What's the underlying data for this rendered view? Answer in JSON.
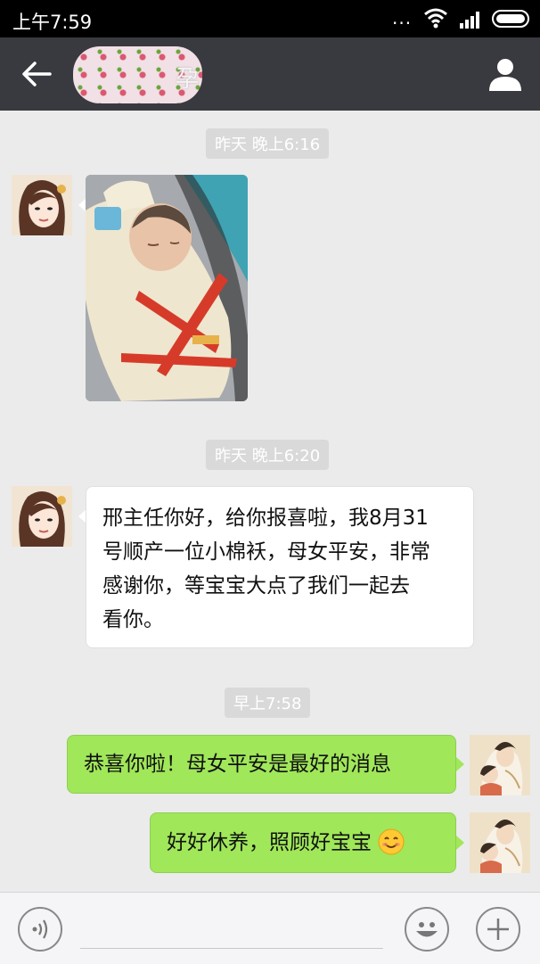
{
  "status_bar": {
    "time": "上午7:59",
    "dots": "..."
  },
  "header": {
    "title": "孕"
  },
  "messages": {
    "ts1": "昨天 晚上6:16",
    "ts2": "昨天 晚上6:20",
    "msg1_lines": [
      "邢主任你好，给你报喜啦，我8月31",
      "号顺产一位小棉袄，母女平安，非常",
      "感谢你，等宝宝大点了我们一起去",
      "看你。"
    ],
    "ts3": "早上7:58",
    "reply1": "恭喜你啦！母女平安是最好的消息",
    "reply2": "好好休养，照顾好宝宝"
  },
  "icons": {
    "back": "back-arrow-icon",
    "profile": "person-icon",
    "voice": "voice-icon",
    "emoji": "smiley-icon",
    "add": "plus-icon"
  },
  "colors": {
    "titlebar": "#393a3f",
    "background": "#ebebeb",
    "sent_bubble": "#a0e75a",
    "received_bubble": "#ffffff",
    "timestamp_bg": "#d9d9d9"
  }
}
